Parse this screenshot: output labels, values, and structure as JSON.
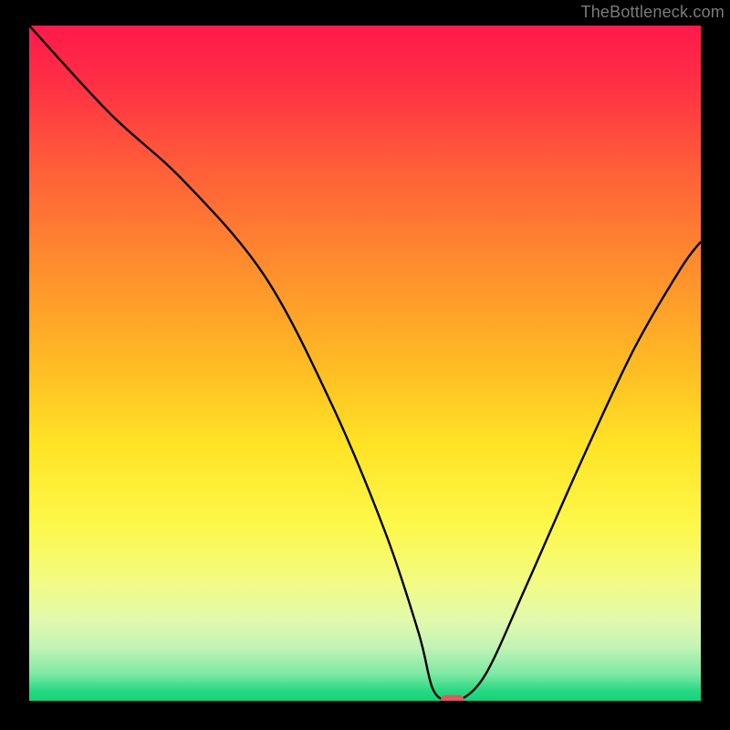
{
  "watermark": "TheBottleneck.com",
  "chart_data": {
    "type": "line",
    "title": "",
    "xlabel": "",
    "ylabel": "",
    "xlim": [
      0,
      100
    ],
    "ylim": [
      0,
      100
    ],
    "grid": false,
    "series": [
      {
        "name": "bottleneck-curve",
        "x": [
          0,
          12,
          23,
          35,
          45,
          53,
          58,
          60,
          62,
          64,
          68,
          74,
          82,
          90,
          97,
          100
        ],
        "values": [
          100,
          87,
          77,
          63,
          44,
          25,
          10,
          2,
          0,
          0,
          4,
          17,
          35,
          52,
          64,
          68
        ]
      }
    ],
    "background_gradient": {
      "stops": [
        {
          "offset": 0.0,
          "color": "#ff1a4b"
        },
        {
          "offset": 0.08,
          "color": "#ff2d45"
        },
        {
          "offset": 0.2,
          "color": "#ff5a3a"
        },
        {
          "offset": 0.35,
          "color": "#ff8b2e"
        },
        {
          "offset": 0.5,
          "color": "#ffba24"
        },
        {
          "offset": 0.62,
          "color": "#ffe325"
        },
        {
          "offset": 0.74,
          "color": "#fdf84a"
        },
        {
          "offset": 0.82,
          "color": "#f3fb80"
        },
        {
          "offset": 0.88,
          "color": "#e2f9ad"
        },
        {
          "offset": 0.92,
          "color": "#c3f4b6"
        },
        {
          "offset": 0.96,
          "color": "#7ee9a4"
        },
        {
          "offset": 0.985,
          "color": "#28d983"
        },
        {
          "offset": 1.0,
          "color": "#14d27a"
        }
      ]
    },
    "marker": {
      "x": 63,
      "y": 0,
      "color": "#d95a5f"
    },
    "axes_color": "#000000",
    "line_color": "#000000"
  }
}
